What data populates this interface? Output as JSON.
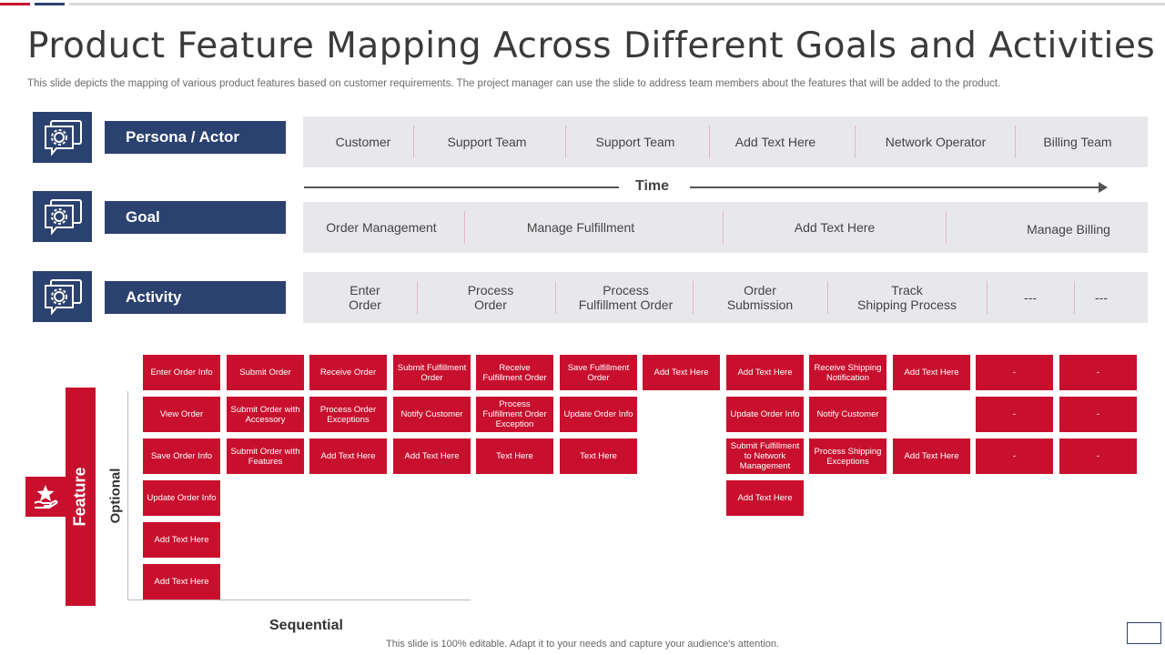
{
  "title": "Product Feature Mapping Across Different Goals and Activities",
  "subtitle": "This slide depicts the mapping of various product features based on customer requirements. The project manager can use the slide to address team members about the features that will be added to the product.",
  "colors": {
    "accent_red": "#c8102e",
    "navy": "#2b4170",
    "band_grey": "#e8e8ec"
  },
  "rows": {
    "persona": {
      "label": "Persona / Actor",
      "icon": "gear-chat-icon",
      "cells": [
        "Customer",
        "Support Team",
        "Support Team",
        "Add Text Here",
        "Network Operator",
        "Billing Team"
      ]
    },
    "goal": {
      "label": "Goal",
      "icon": "gear-chat-icon",
      "cells": [
        "Order Management",
        "Manage Fulfillment",
        "Add Text Here",
        "Manage Billing"
      ]
    },
    "activity": {
      "label": "Activity",
      "icon": "gear-chat-icon",
      "cells": [
        "Enter\nOrder",
        "Process\nOrder",
        "Process\nFulfillment Order",
        "Order\nSubmission",
        "Track\nShipping Process",
        "---",
        "---"
      ]
    }
  },
  "time_label": "Time",
  "feature_label": "Feature",
  "feature_icon": "hand-star-icon",
  "optional_label": "Optional",
  "sequential_label": "Sequential",
  "features": {
    "col1": [
      "Enter Order Info",
      "View Order",
      "Save Order Info",
      "Update Order Info",
      "Add Text Here",
      "Add Text Here"
    ],
    "col2": [
      "Submit Order",
      "Submit Order with Accessory",
      "Submit Order with Features"
    ],
    "col3": [
      "Receive Order",
      "Process Order Exceptions",
      "Add Text Here"
    ],
    "col4": [
      "Submit Fulfillment Order",
      "Notify Customer",
      "Add Text Here"
    ],
    "col5": [
      "Receive Fulfillment Order",
      "Process Fulfillment Order Exception",
      "Text Here"
    ],
    "col6": [
      "Save Fulfillment Order",
      "Update Order Info",
      "Text Here"
    ],
    "col7": [
      "Add Text Here"
    ],
    "col8": [
      "Add Text Here",
      "Update Order Info",
      "Submit Fulfillment to Network Management",
      "Add Text Here"
    ],
    "col9": [
      "Receive Shipping Notification",
      "Notify Customer",
      "Process Shipping Exceptions"
    ],
    "col10_r1": "Add Text Here",
    "col10_r3": "Add Text Here",
    "col11": [
      "-",
      "-",
      "-"
    ],
    "col12": [
      "-",
      "-",
      "-"
    ]
  },
  "footer": "This slide is 100% editable. Adapt it to your needs and capture your audience's attention."
}
